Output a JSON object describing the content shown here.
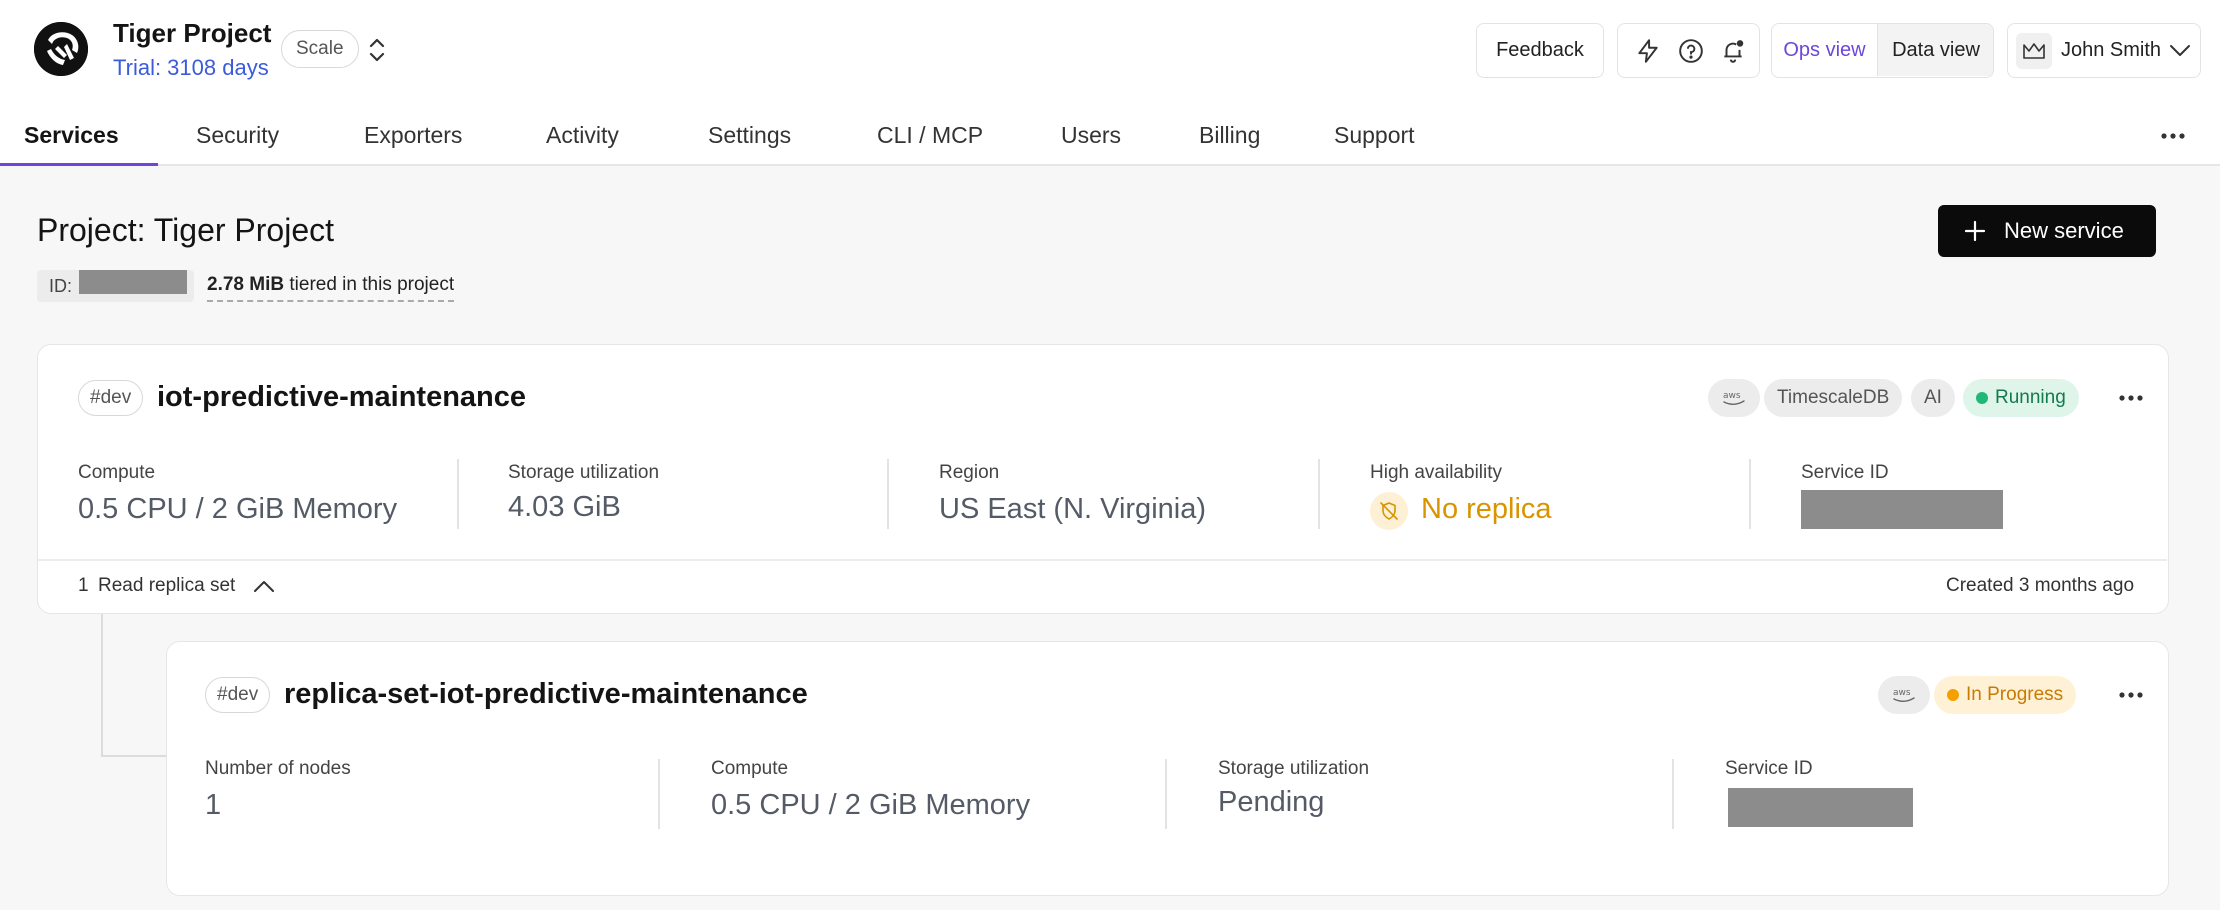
{
  "header": {
    "project_name": "Tiger Project",
    "trial": "Trial: 3108 days",
    "plan_badge": "Scale",
    "feedback_label": "Feedback",
    "ops_view_label": "Ops view",
    "data_view_label": "Data view",
    "user_name": "John Smith"
  },
  "tabs": [
    {
      "label": "Services"
    },
    {
      "label": "Security"
    },
    {
      "label": "Exporters"
    },
    {
      "label": "Activity"
    },
    {
      "label": "Settings"
    },
    {
      "label": "CLI / MCP"
    },
    {
      "label": "Users"
    },
    {
      "label": "Billing"
    },
    {
      "label": "Support"
    }
  ],
  "page": {
    "title": "Project: Tiger Project",
    "id_label": "ID:",
    "tiered_amount": "2.78 MiB",
    "tiered_suffix": " tiered in this project",
    "new_service_label": "New service"
  },
  "service": {
    "env_tag": "#dev",
    "name": "iot-predictive-maintenance",
    "badges": {
      "engine": "TimescaleDB",
      "ai": "AI",
      "status": "Running"
    },
    "metrics": {
      "compute_label": "Compute",
      "compute_value": "0.5 CPU / 2 GiB Memory",
      "storage_label": "Storage utilization",
      "storage_value": "4.03 GiB",
      "region_label": "Region",
      "region_value": "US East (N. Virginia)",
      "ha_label": "High availability",
      "ha_value": "No replica",
      "service_id_label": "Service ID"
    },
    "replica_count": "1",
    "replica_label": "Read replica set",
    "created": "Created 3 months ago"
  },
  "replica": {
    "env_tag": "#dev",
    "name": "replica-set-iot-predictive-maintenance",
    "status": "In Progress",
    "metrics": {
      "nodes_label": "Number of nodes",
      "nodes_value": "1",
      "compute_label": "Compute",
      "compute_value": "0.5 CPU / 2 GiB Memory",
      "storage_label": "Storage utilization",
      "storage_value": "Pending",
      "service_id_label": "Service ID"
    }
  },
  "icons": {
    "logo": "tiger-logo-icon",
    "switch": "chevron-up-down-icon",
    "bolt": "lightning-icon",
    "help": "help-circle-icon",
    "bell": "bell-icon",
    "crown": "crown-icon",
    "more": "more-horizontal-icon",
    "plus": "plus-icon",
    "aws": "aws-icon",
    "no_replica": "shield-off-icon",
    "caret": "chevron-up-icon"
  },
  "colors": {
    "accent": "#6c47d9",
    "trial_link": "#3b5bdb",
    "running_bg": "#dff5ea",
    "running_dot": "#1fb877",
    "progress_bg": "#fff1d6",
    "progress_dot": "#f59f00",
    "warning": "#d99400"
  }
}
